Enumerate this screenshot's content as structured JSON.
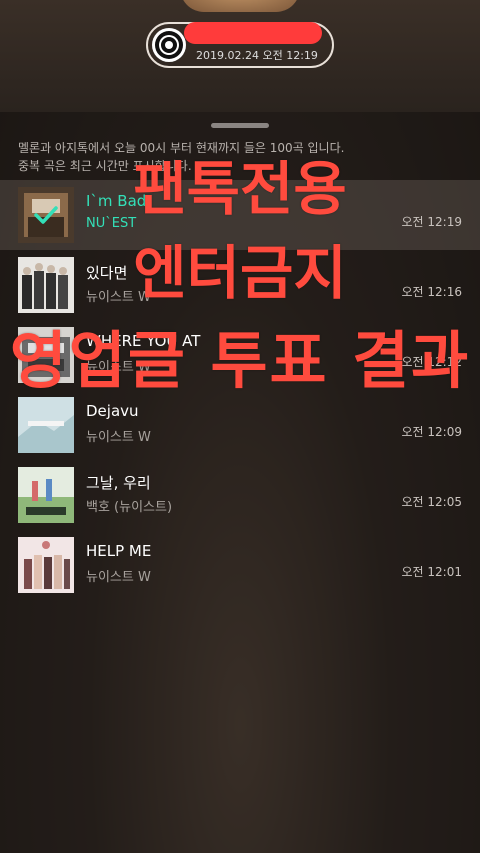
{
  "now_playing": {
    "timestamp": "2019.02.24 오전 12:19"
  },
  "notice": {
    "line1": "멜론과 아지톡에서 오늘 00시 부터 현재까지 들은 100곡 입니다.",
    "line2": "중복 곡은 최근 시간만 표시합니다."
  },
  "songs": [
    {
      "title": "I`m Bad",
      "artist": "NU`EST",
      "time": "오전 12:19",
      "selected": true
    },
    {
      "title": "있다면",
      "artist": "뉴이스트 W",
      "time": "오전 12:16"
    },
    {
      "title": "WHERE YOU AT",
      "artist": "뉴이스트 W",
      "time": "오전 12:12"
    },
    {
      "title": "Dejavu",
      "artist": "뉴이스트 W",
      "time": "오전 12:09"
    },
    {
      "title": "그날, 우리",
      "artist": "백호 (뉴이스트)",
      "time": "오전 12:05"
    },
    {
      "title": "HELP ME",
      "artist": "뉴이스트 W",
      "time": "오전 12:01"
    }
  ],
  "overlay": {
    "line1": "팬톡전용",
    "line2": "엔터금지",
    "line3": "영업글 투표 결과"
  },
  "colors": {
    "accent": "#33e0b8",
    "overlay_red": "#ff4b3e"
  }
}
